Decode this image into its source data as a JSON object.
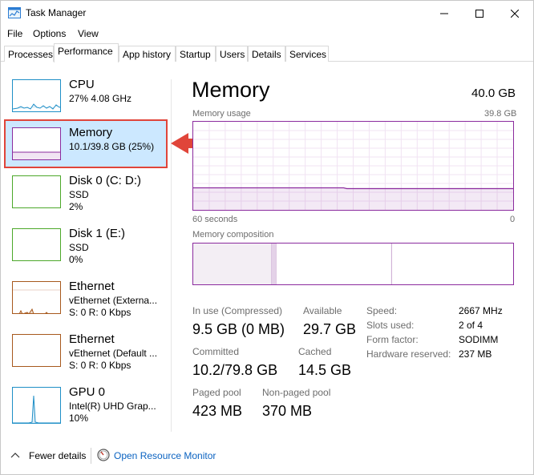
{
  "window": {
    "title": "Task Manager",
    "accent": "#8b2b9e",
    "callout_color": "#e0453a"
  },
  "menu": [
    "File",
    "Options",
    "View"
  ],
  "tabs": [
    "Processes",
    "Performance",
    "App history",
    "Startup",
    "Users",
    "Details",
    "Services"
  ],
  "active_tab": "Performance",
  "sidebar": [
    {
      "name": "CPU",
      "sub1": "27%  4.08 GHz",
      "sub2": "",
      "sub3": "",
      "color": "#1f8fc7"
    },
    {
      "name": "Memory",
      "sub1": "10.1/39.8 GB (25%)",
      "sub2": "",
      "sub3": "",
      "color": "#8b2b9e"
    },
    {
      "name": "Disk 0 (C: D:)",
      "sub1": "SSD",
      "sub2": "2%",
      "sub3": "",
      "color": "#4ca82a"
    },
    {
      "name": "Disk 1 (E:)",
      "sub1": "SSD",
      "sub2": "0%",
      "sub3": "",
      "color": "#4ca82a"
    },
    {
      "name": "Ethernet",
      "sub1": "vEthernet (Externa...",
      "sub2": "S: 0  R: 0 Kbps",
      "sub3": "",
      "color": "#a7591d"
    },
    {
      "name": "Ethernet",
      "sub1": "vEthernet (Default ...",
      "sub2": "S: 0  R: 0 Kbps",
      "sub3": "",
      "color": "#a7591d"
    },
    {
      "name": "GPU 0",
      "sub1": "Intel(R) UHD Grap...",
      "sub2": "10%",
      "sub3": "",
      "color": "#1f8fc7"
    }
  ],
  "main": {
    "title": "Memory",
    "total": "40.0 GB",
    "usage_label": "Memory usage",
    "usage_max": "39.8 GB",
    "time_left": "60 seconds",
    "time_right": "0",
    "usage_level": 0.25,
    "composition_label": "Memory composition",
    "composition": {
      "in_use": 0.245,
      "modified": 0.015,
      "standby": 0.36
    },
    "stats": {
      "in_use_label": "In use (Compressed)",
      "in_use_value": "9.5 GB (0 MB)",
      "available_label": "Available",
      "available_value": "29.7 GB",
      "committed_label": "Committed",
      "committed_value": "10.2/79.8 GB",
      "cached_label": "Cached",
      "cached_value": "14.5 GB",
      "paged_label": "Paged pool",
      "paged_value": "423 MB",
      "nonpaged_label": "Non-paged pool",
      "nonpaged_value": "370 MB"
    },
    "details": [
      {
        "label": "Speed:",
        "value": "2667 MHz"
      },
      {
        "label": "Slots used:",
        "value": "2 of 4"
      },
      {
        "label": "Form factor:",
        "value": "SODIMM"
      },
      {
        "label": "Hardware reserved:",
        "value": "237 MB"
      }
    ]
  },
  "footer": {
    "fewer_details": "Fewer details",
    "resource_monitor": "Open Resource Monitor"
  }
}
